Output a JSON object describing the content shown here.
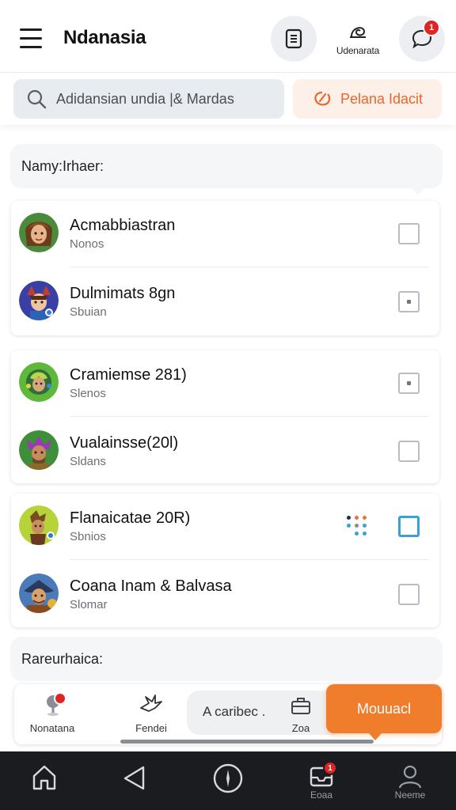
{
  "header": {
    "title": "Ndanasia",
    "user_label": "Udenarata",
    "chat_badge": "1"
  },
  "search": {
    "placeholder": "Adidansian undia |& Mardas",
    "promo_label": "Pelana Idacit"
  },
  "sections": {
    "top_title": "Namy:Irhaer:",
    "bottom_title": "Rareurhaica:"
  },
  "items": [
    {
      "name": "Acmabbiastran",
      "sub": "Nonos",
      "check": "empty"
    },
    {
      "name": "Dulmimats 8gn",
      "sub": "Sbuian",
      "check": "partial"
    },
    {
      "name": "Cramiemse 281)",
      "sub": "Slenos",
      "check": "partial"
    },
    {
      "name": "Vualainsse(20l)",
      "sub": "Sldans",
      "check": "empty"
    },
    {
      "name": "Flanaicatae 20R)",
      "sub": "Sbnios",
      "check": "active"
    },
    {
      "name": "Coana Inam & Balvasa",
      "sub": "Slomar",
      "check": "empty"
    }
  ],
  "action_bar": {
    "item1_label": "Nonatana",
    "item2_label": "Fendei",
    "pill_label": "A caribec .",
    "item4_label": "Zoa",
    "primary_label": "Mouuacl"
  },
  "system_nav": {
    "inbox_label": "Eoaa",
    "inbox_badge": "1",
    "profile_label": "Neeme"
  },
  "colors": {
    "accent": "#ef7d2c",
    "promo_text": "#e8672a",
    "badge": "#e02424",
    "checkbox_active": "#3aa0d8"
  }
}
